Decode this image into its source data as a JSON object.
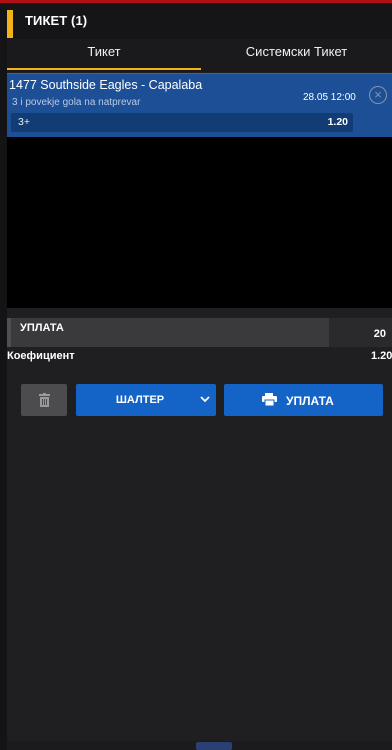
{
  "ticket": {
    "title": "ТИКЕТ (1)",
    "tabs": [
      {
        "label": "Тикет",
        "active": true
      },
      {
        "label": "Системски Тикет",
        "active": false
      }
    ]
  },
  "selection": {
    "match": "1477 Southside Eagles - Capalaba",
    "market": "3 i povekje gola na natprevar",
    "datetime": "28.05 12:00",
    "pick": "3+",
    "odds": "1.20"
  },
  "stake": {
    "label": "УПЛАТА",
    "value": "20"
  },
  "coefficient": {
    "label": "Коефициент",
    "value": "1.20"
  },
  "actions": {
    "shalter_label": "ШАЛТЕР",
    "pay_label": "УПЛАТА"
  },
  "colors": {
    "accent": "#f3b21a",
    "selection_bg": "#1c4f96",
    "button_blue": "#1463c7",
    "top_bar": "#b10f16"
  },
  "icons": {
    "close": "close-circle-icon",
    "delete": "trash-icon",
    "dropdown": "chevron-down-icon",
    "pay": "printer-icon"
  }
}
